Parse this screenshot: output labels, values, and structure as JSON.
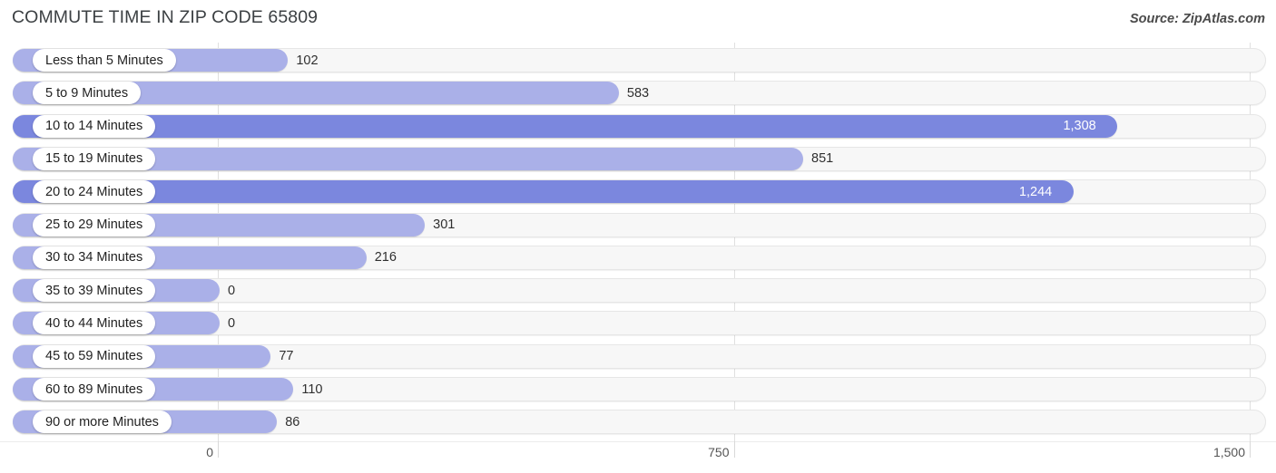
{
  "header": {
    "title": "COMMUTE TIME IN ZIP CODE 65809",
    "source": "Source: ZipAtlas.com"
  },
  "colors": {
    "bar_light": "#aab0e8",
    "bar_dark": "#7b87de",
    "track": "#f7f7f7",
    "gridline": "#e0e0e0",
    "title_text": "#3c4043"
  },
  "axis": {
    "ticks": [
      "0",
      "750",
      "1,500"
    ],
    "tick_values": [
      0,
      750,
      1500
    ]
  },
  "chart_data": {
    "type": "bar",
    "orientation": "horizontal",
    "title": "COMMUTE TIME IN ZIP CODE 65809",
    "subtitle": "Source: ZipAtlas.com",
    "xlabel": "",
    "ylabel": "",
    "xlim": [
      0,
      1500
    ],
    "grid": true,
    "legend": "none",
    "categories": [
      "Less than 5 Minutes",
      "5 to 9 Minutes",
      "10 to 14 Minutes",
      "15 to 19 Minutes",
      "20 to 24 Minutes",
      "25 to 29 Minutes",
      "30 to 34 Minutes",
      "35 to 39 Minutes",
      "40 to 44 Minutes",
      "45 to 59 Minutes",
      "60 to 89 Minutes",
      "90 or more Minutes"
    ],
    "values": [
      102,
      583,
      1308,
      851,
      1244,
      301,
      216,
      0,
      0,
      77,
      110,
      86
    ],
    "value_labels": [
      "102",
      "583",
      "1,308",
      "851",
      "1,244",
      "301",
      "216",
      "0",
      "0",
      "77",
      "110",
      "86"
    ],
    "xticks": [
      0,
      750,
      1500
    ],
    "xticklabels": [
      "0",
      "750",
      "1,500"
    ]
  },
  "rows": [
    {
      "label": "Less than 5 Minutes",
      "value": 102,
      "value_label": "102",
      "shade": "light",
      "label_inside": false
    },
    {
      "label": "5 to 9 Minutes",
      "value": 583,
      "value_label": "583",
      "shade": "light",
      "label_inside": false
    },
    {
      "label": "10 to 14 Minutes",
      "value": 1308,
      "value_label": "1,308",
      "shade": "dark",
      "label_inside": true
    },
    {
      "label": "15 to 19 Minutes",
      "value": 851,
      "value_label": "851",
      "shade": "light",
      "label_inside": false
    },
    {
      "label": "20 to 24 Minutes",
      "value": 1244,
      "value_label": "1,244",
      "shade": "dark",
      "label_inside": true
    },
    {
      "label": "25 to 29 Minutes",
      "value": 301,
      "value_label": "301",
      "shade": "light",
      "label_inside": false
    },
    {
      "label": "30 to 34 Minutes",
      "value": 216,
      "value_label": "216",
      "shade": "light",
      "label_inside": false
    },
    {
      "label": "35 to 39 Minutes",
      "value": 0,
      "value_label": "0",
      "shade": "light",
      "label_inside": false
    },
    {
      "label": "40 to 44 Minutes",
      "value": 0,
      "value_label": "0",
      "shade": "light",
      "label_inside": false
    },
    {
      "label": "45 to 59 Minutes",
      "value": 77,
      "value_label": "77",
      "shade": "light",
      "label_inside": false
    },
    {
      "label": "60 to 89 Minutes",
      "value": 110,
      "value_label": "110",
      "shade": "light",
      "label_inside": false
    },
    {
      "label": "90 or more Minutes",
      "value": 86,
      "value_label": "86",
      "shade": "light",
      "label_inside": false
    }
  ]
}
